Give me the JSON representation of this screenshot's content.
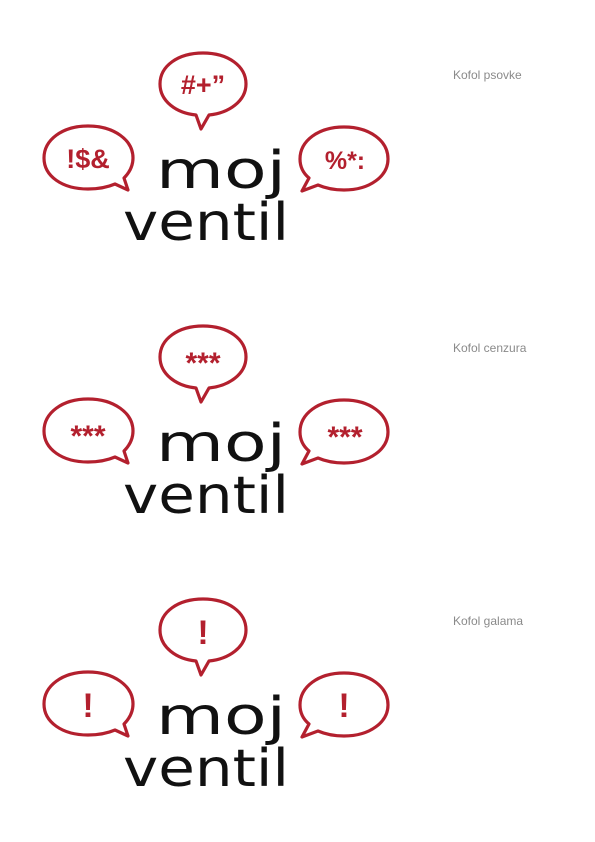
{
  "brand": {
    "word_line1": "moj",
    "word_line2": "ventil",
    "accent_color": "#b3202e",
    "text_color": "#111111",
    "caption_color": "#8a8a8a"
  },
  "variants": [
    {
      "caption": "Kofol psovke",
      "bubble_left": "!$&",
      "bubble_top": "#+”",
      "bubble_right": "%*:"
    },
    {
      "caption": "Kofol cenzura",
      "bubble_left": "***",
      "bubble_top": "***",
      "bubble_right": "***"
    },
    {
      "caption": "Kofol galama",
      "bubble_left": "!",
      "bubble_top": "!",
      "bubble_right": "!"
    }
  ]
}
